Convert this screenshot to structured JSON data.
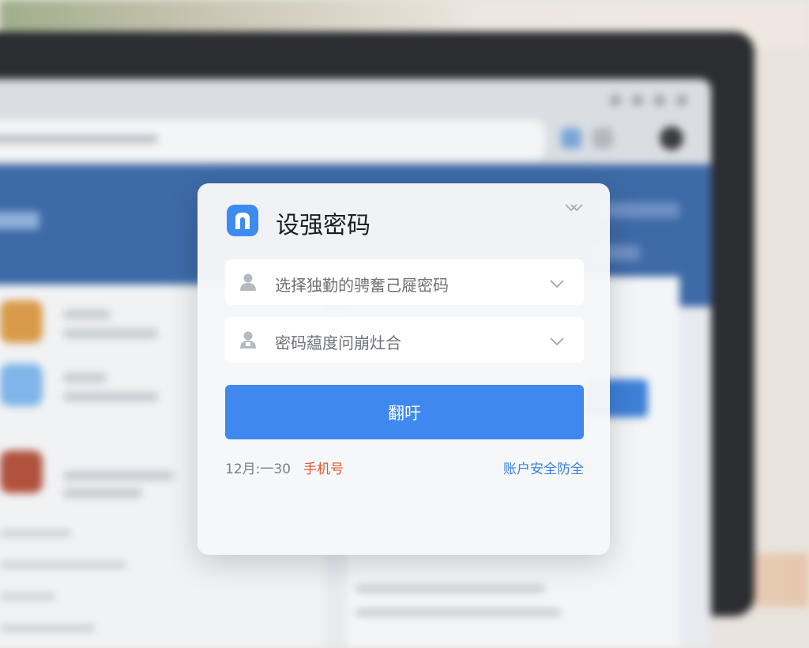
{
  "dialog": {
    "title": "设强密码",
    "account_select": {
      "placeholder": "选择独勤的骋奮己屣密码",
      "icon": "user-icon"
    },
    "password_rule_select": {
      "placeholder": "密码藴度问崩灶合",
      "icon": "lock-user-icon"
    },
    "primary_button": "翻吁",
    "footer": {
      "date_text": "12月:一30",
      "phone_link": "手机号",
      "security_link": "账户安全防全"
    }
  },
  "colors": {
    "accent": "#3e88f0",
    "footer_link_red": "#e05a2f",
    "footer_link_blue": "#3b83e6"
  }
}
